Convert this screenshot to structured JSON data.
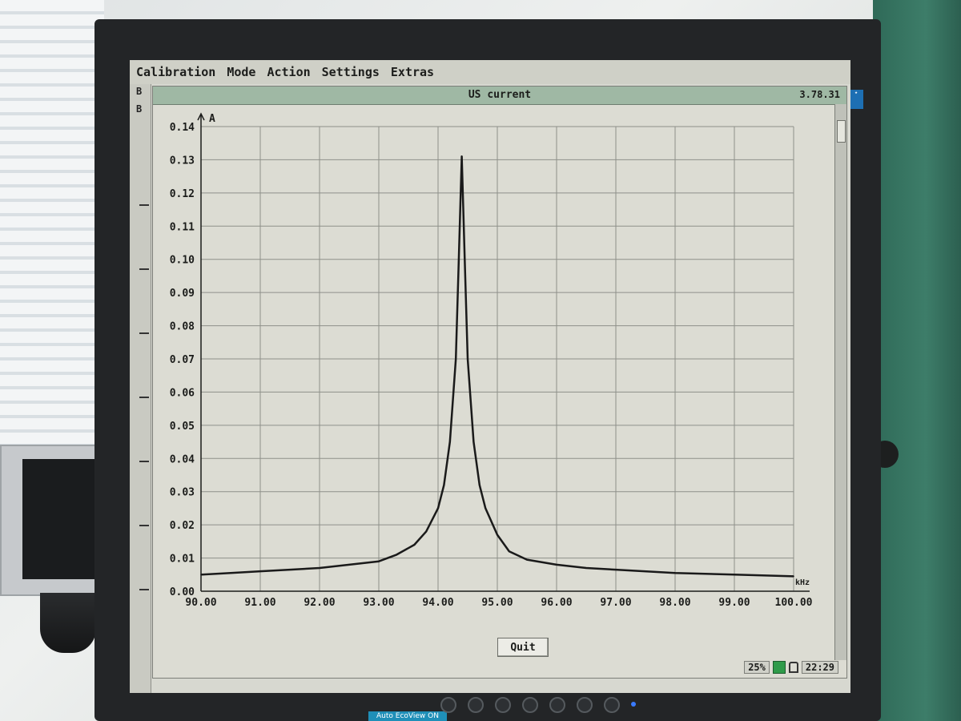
{
  "menu": {
    "items": [
      "Calibration",
      "Mode",
      "Action",
      "Settings",
      "Extras"
    ]
  },
  "left_strip": {
    "stubs": [
      "B",
      "B"
    ]
  },
  "window": {
    "title": "US current",
    "version": "3.78.31"
  },
  "buttons": {
    "quit_label": "Quit"
  },
  "status": {
    "zoom": "25%",
    "time": "22:29"
  },
  "monitor": {
    "eco_label": "Auto EcoView ON"
  },
  "colors": {
    "screen_bg": "#d7d8d0",
    "titlebar": "#9fb8a4",
    "curve": "#1a1a1a",
    "grid": "#8e908a",
    "status_green": "#2f9b4a"
  },
  "chart_data": {
    "type": "line",
    "title": "US current",
    "xlabel": "kHz",
    "ylabel": "A",
    "xlim": [
      90.0,
      100.0
    ],
    "ylim": [
      0.0,
      0.14
    ],
    "x_ticks": [
      "90.00",
      "91.00",
      "92.00",
      "93.00",
      "94.00",
      "95.00",
      "96.00",
      "97.00",
      "98.00",
      "99.00",
      "100.00"
    ],
    "y_ticks": [
      "0.00",
      "0.01",
      "0.02",
      "0.03",
      "0.04",
      "0.05",
      "0.06",
      "0.07",
      "0.08",
      "0.09",
      "0.10",
      "0.11",
      "0.12",
      "0.13",
      "0.14"
    ],
    "grid": true,
    "series": [
      {
        "x": [
          90.0,
          90.5,
          91.0,
          91.5,
          92.0,
          92.5,
          93.0,
          93.3,
          93.6,
          93.8,
          94.0,
          94.1,
          94.2,
          94.3,
          94.35,
          94.4,
          94.45,
          94.5,
          94.6,
          94.7,
          94.8,
          95.0,
          95.2,
          95.5,
          96.0,
          96.5,
          97.0,
          98.0,
          99.0,
          100.0
        ],
        "y": [
          0.005,
          0.0055,
          0.006,
          0.0065,
          0.007,
          0.008,
          0.009,
          0.011,
          0.014,
          0.018,
          0.025,
          0.032,
          0.045,
          0.07,
          0.1,
          0.131,
          0.1,
          0.07,
          0.045,
          0.032,
          0.025,
          0.017,
          0.012,
          0.0095,
          0.008,
          0.007,
          0.0065,
          0.0055,
          0.005,
          0.0045
        ]
      }
    ]
  }
}
